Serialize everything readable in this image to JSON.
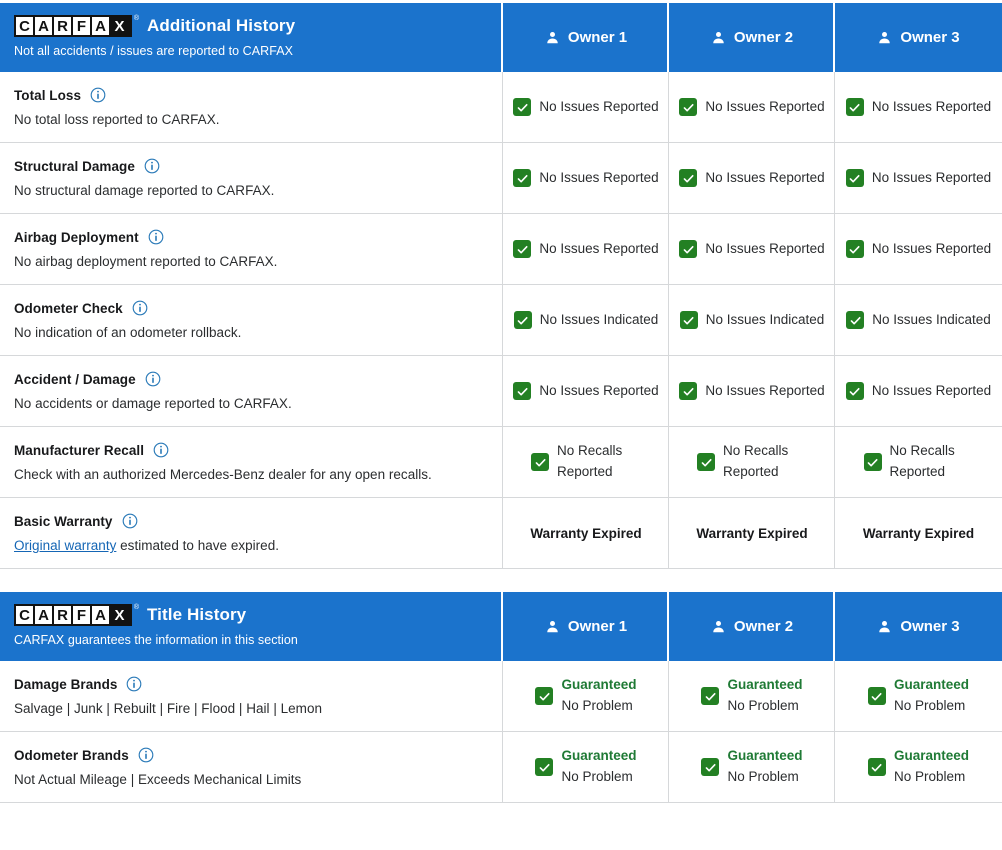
{
  "logo": {
    "letters": [
      "C",
      "A",
      "R",
      "F",
      "A"
    ],
    "last_letter": "X",
    "registered_mark": "®"
  },
  "sections": [
    {
      "id": "additional-history",
      "title": "Additional History",
      "subtitle": "Not all accidents / issues are reported to CARFAX",
      "columns": [
        {
          "label": "Owner 1",
          "icon": "person-icon"
        },
        {
          "label": "Owner 2",
          "icon": "person-icon"
        },
        {
          "label": "Owner 3",
          "icon": "person-icon"
        }
      ],
      "rows": [
        {
          "title": "Total Loss",
          "info_icon": "info-icon",
          "desc": "No total loss reported to CARFAX.",
          "cells": [
            {
              "type": "check",
              "text": "No Issues Reported"
            },
            {
              "type": "check",
              "text": "No Issues Reported"
            },
            {
              "type": "check",
              "text": "No Issues Reported"
            }
          ]
        },
        {
          "title": "Structural Damage",
          "info_icon": "info-icon",
          "desc": "No structural damage reported to CARFAX.",
          "cells": [
            {
              "type": "check",
              "text": "No Issues Reported"
            },
            {
              "type": "check",
              "text": "No Issues Reported"
            },
            {
              "type": "check",
              "text": "No Issues Reported"
            }
          ]
        },
        {
          "title": "Airbag Deployment",
          "info_icon": "info-icon",
          "desc": "No airbag deployment reported to CARFAX.",
          "cells": [
            {
              "type": "check",
              "text": "No Issues Reported"
            },
            {
              "type": "check",
              "text": "No Issues Reported"
            },
            {
              "type": "check",
              "text": "No Issues Reported"
            }
          ]
        },
        {
          "title": "Odometer Check",
          "info_icon": "info-icon",
          "desc": "No indication of an odometer rollback.",
          "cells": [
            {
              "type": "check",
              "text": "No Issues Indicated"
            },
            {
              "type": "check",
              "text": "No Issues Indicated"
            },
            {
              "type": "check",
              "text": "No Issues Indicated"
            }
          ]
        },
        {
          "title": "Accident / Damage",
          "info_icon": "info-icon",
          "desc": "No accidents or damage reported to CARFAX.",
          "cells": [
            {
              "type": "check",
              "text": "No Issues Reported"
            },
            {
              "type": "check",
              "text": "No Issues Reported"
            },
            {
              "type": "check",
              "text": "No Issues Reported"
            }
          ]
        },
        {
          "title": "Manufacturer Recall",
          "info_icon": "info-icon",
          "desc": "Check with an authorized Mercedes-Benz dealer for any open recalls.",
          "cells": [
            {
              "type": "check-narrow",
              "text": "No Recalls Reported"
            },
            {
              "type": "check-narrow",
              "text": "No Recalls Reported"
            },
            {
              "type": "check-narrow",
              "text": "No Recalls Reported"
            }
          ]
        },
        {
          "title": "Basic Warranty",
          "info_icon": "info-icon",
          "desc_link": "Original warranty",
          "desc_rest": " estimated to have expired.",
          "cells": [
            {
              "type": "plain",
              "text": "Warranty Expired"
            },
            {
              "type": "plain",
              "text": "Warranty Expired"
            },
            {
              "type": "plain",
              "text": "Warranty Expired"
            }
          ]
        }
      ]
    },
    {
      "id": "title-history",
      "title": "Title History",
      "subtitle": "CARFAX guarantees the information in this section",
      "columns": [
        {
          "label": "Owner 1",
          "icon": "person-icon"
        },
        {
          "label": "Owner 2",
          "icon": "person-icon"
        },
        {
          "label": "Owner 3",
          "icon": "person-icon"
        }
      ],
      "rows": [
        {
          "title": "Damage Brands",
          "info_icon": "info-icon",
          "desc": "Salvage | Junk | Rebuilt | Fire | Flood | Hail | Lemon",
          "cells": [
            {
              "type": "guaranteed",
              "line1": "Guaranteed",
              "line2": "No Problem"
            },
            {
              "type": "guaranteed",
              "line1": "Guaranteed",
              "line2": "No Problem"
            },
            {
              "type": "guaranteed",
              "line1": "Guaranteed",
              "line2": "No Problem"
            }
          ]
        },
        {
          "title": "Odometer Brands",
          "info_icon": "info-icon",
          "desc": "Not Actual Mileage | Exceeds Mechanical Limits",
          "cells": [
            {
              "type": "guaranteed",
              "line1": "Guaranteed",
              "line2": "No Problem"
            },
            {
              "type": "guaranteed",
              "line1": "Guaranteed",
              "line2": "No Problem"
            },
            {
              "type": "guaranteed",
              "line1": "Guaranteed",
              "line2": "No Problem"
            }
          ]
        }
      ]
    }
  ],
  "colors": {
    "header_blue": "#1b73cc",
    "check_green": "#238023",
    "guaranteed_green": "#1f7a35",
    "link_blue": "#1566b5",
    "border_gray": "#d6d8da"
  }
}
